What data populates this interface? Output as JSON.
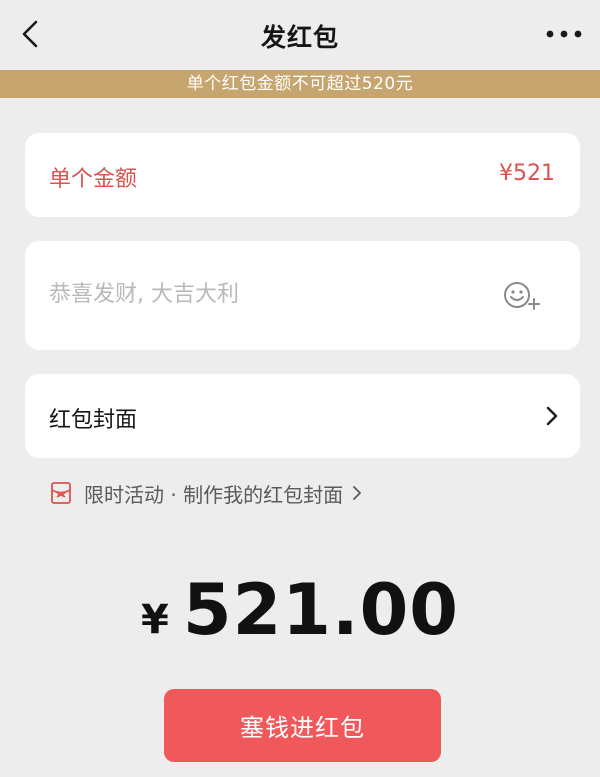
{
  "navbar": {
    "title": "发红包",
    "back_icon": "chevron-left-icon",
    "more_icon": "more-dots-icon"
  },
  "warning": {
    "text": "单个红包金额不可超过520元"
  },
  "amount": {
    "label": "单个金额",
    "value": "¥521"
  },
  "message": {
    "placeholder": "恭喜发财, 大吉大利",
    "value": "",
    "emoji_icon": "emoji-add-icon"
  },
  "cover": {
    "label": "红包封面",
    "chevron_icon": "chevron-right-icon"
  },
  "promo": {
    "text": "限时活动 · 制作我的红包封面",
    "icon": "red-envelope-cover-icon"
  },
  "total": {
    "currency": "¥",
    "value": "521.00"
  },
  "submit": {
    "label": "塞钱进红包"
  },
  "colors": {
    "background": "#ededed",
    "warning_banner": "#c7a56e",
    "error_text": "#d9534f",
    "button": "#f0585c",
    "button_text": "#ffffff"
  }
}
